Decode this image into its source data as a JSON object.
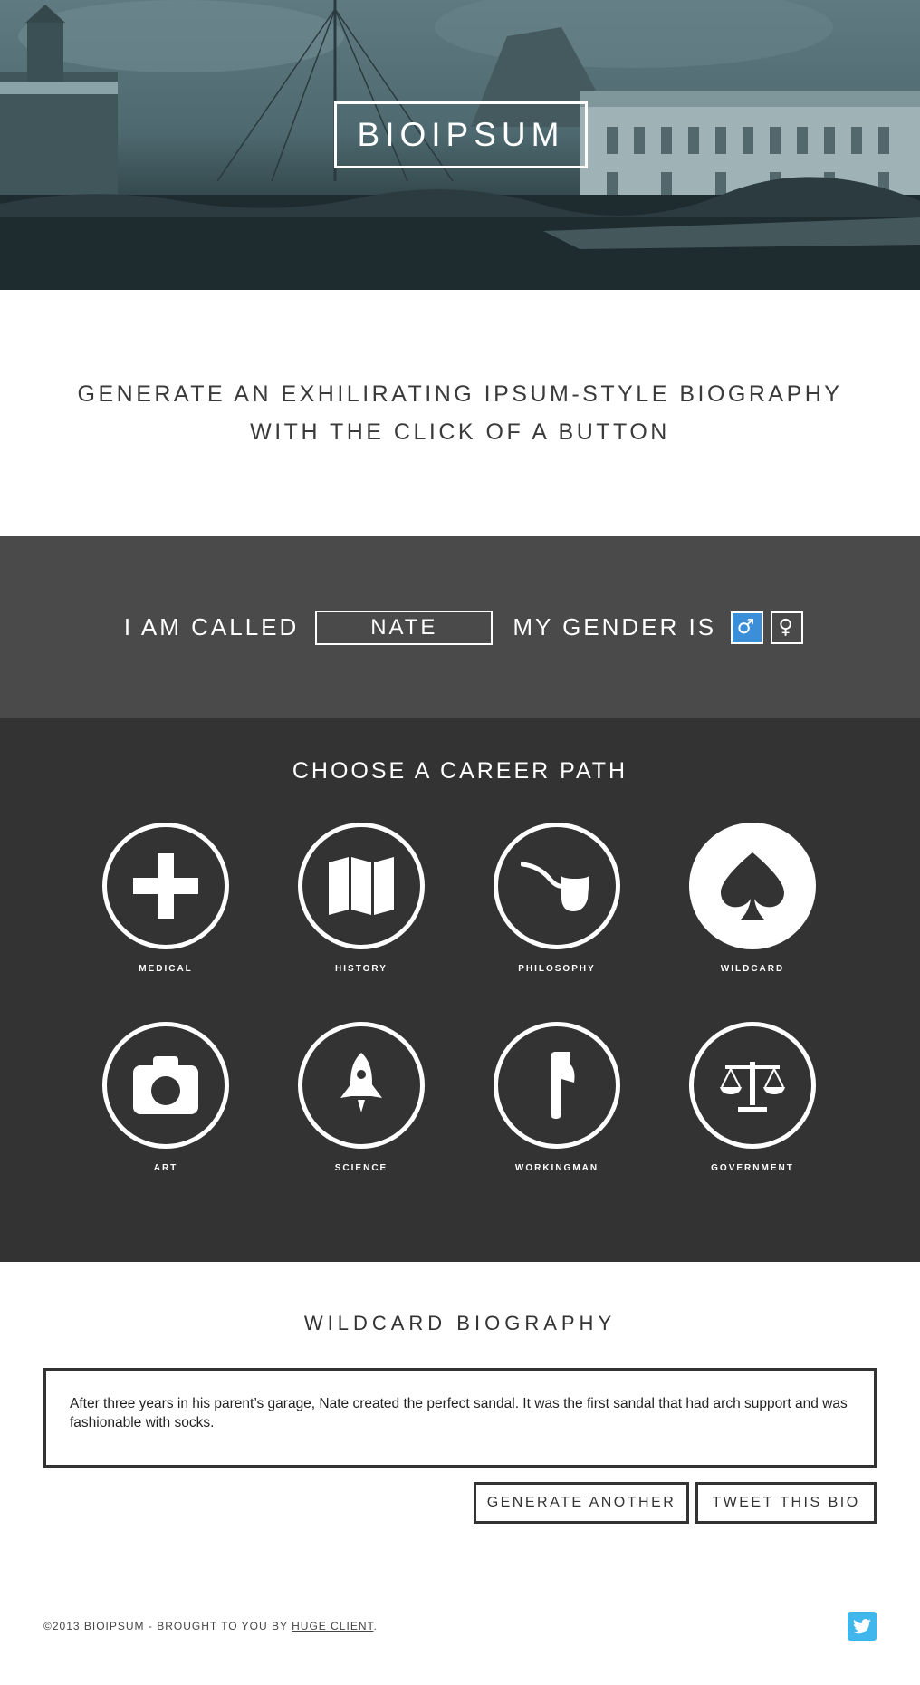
{
  "hero": {
    "logo": "BIOIPSUM"
  },
  "tagline": {
    "line1": "GENERATE AN EXHILIRATING IPSUM-STYLE BIOGRAPHY",
    "line2": "WITH THE CLICK OF A BUTTON"
  },
  "form": {
    "name_label": "I AM CALLED",
    "name_value": "NATE",
    "gender_label": "MY GENDER IS",
    "gender_male": "♂",
    "gender_female": "♀",
    "selected_gender": "male",
    "accent_color": "#3a8fd8"
  },
  "career": {
    "title": "CHOOSE A CAREER PATH",
    "selected": "WILDCARD",
    "items": [
      {
        "label": "MEDICAL",
        "icon": "medical-cross-icon"
      },
      {
        "label": "HISTORY",
        "icon": "map-icon"
      },
      {
        "label": "PHILOSOPHY",
        "icon": "pipe-icon"
      },
      {
        "label": "WILDCARD",
        "icon": "spade-icon"
      },
      {
        "label": "ART",
        "icon": "camera-icon"
      },
      {
        "label": "SCIENCE",
        "icon": "rocket-icon"
      },
      {
        "label": "WORKINGMAN",
        "icon": "axe-icon"
      },
      {
        "label": "GOVERNMENT",
        "icon": "scales-icon"
      }
    ]
  },
  "bio": {
    "title": "WILDCARD BIOGRAPHY",
    "text": "After three years in his parent’s garage, Nate created the perfect sandal. It was the first sandal that had arch support and was fashionable with socks.",
    "generate_label": "GENERATE ANOTHER",
    "tweet_label": "TWEET THIS BIO"
  },
  "footer": {
    "prefix": "©2013 BIOIPSUM - BROUGHT TO YOU BY ",
    "link": "HUGE CLIENT",
    "suffix": ".",
    "twitter_color": "#3fb6ec",
    "twitter_icon": "twitter-bird-icon"
  }
}
